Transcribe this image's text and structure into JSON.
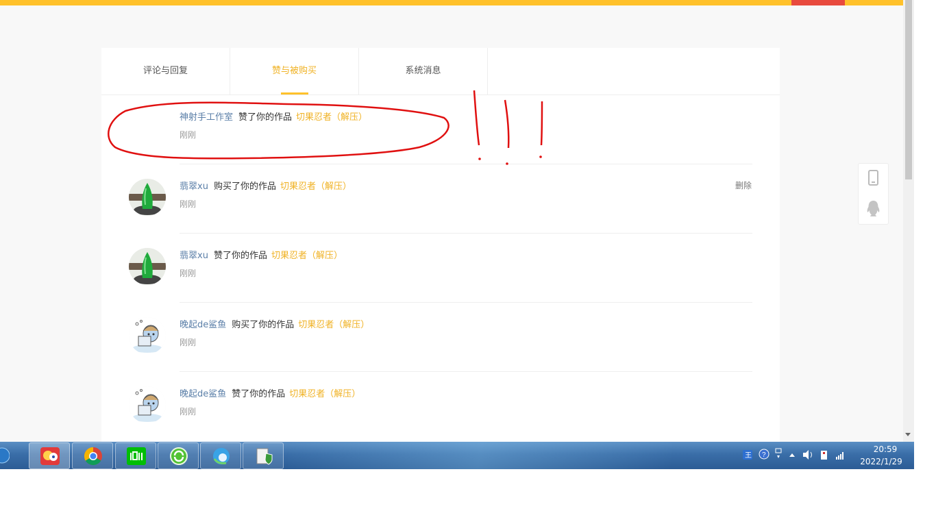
{
  "tabs": [
    {
      "label": "评论与回复",
      "active": false
    },
    {
      "label": "赞与被购买",
      "active": true
    },
    {
      "label": "系统消息",
      "active": false
    }
  ],
  "messages": [
    {
      "user": "神射手工作室",
      "action": "赞了你的作品",
      "work": "切果忍者（解压）",
      "time": "刚刚",
      "avatar": "none"
    },
    {
      "user": "翡翠xu",
      "action": "购买了你的作品",
      "work": "切果忍者（解压）",
      "time": "刚刚",
      "avatar": "jade",
      "delete": "删除"
    },
    {
      "user": "翡翠xu",
      "action": "赞了你的作品",
      "work": "切果忍者（解压）",
      "time": "刚刚",
      "avatar": "jade"
    },
    {
      "user": "晚起de鲨鱼",
      "action": "购买了你的作品",
      "work": "切果忍者（解压）",
      "time": "刚刚",
      "avatar": "cartoon"
    },
    {
      "user": "晚起de鲨鱼",
      "action": "赞了你的作品",
      "work": "切果忍者（解压）",
      "time": "刚刚",
      "avatar": "cartoon"
    }
  ],
  "side_tools": [
    "mobile-icon",
    "qq-penguin-icon"
  ],
  "taskbar": {
    "apps": [
      "game-app-icon",
      "chrome-icon",
      "iqiyi-icon",
      "ie-refresh-icon",
      "edge-icon",
      "security-app-icon"
    ],
    "clock_time": "20:59",
    "clock_date": "2022/1/29"
  },
  "colors": {
    "accent": "#ffc12a",
    "work_link": "#f0b224",
    "user_link": "#5b7fa8",
    "annotation": "#e01010"
  }
}
